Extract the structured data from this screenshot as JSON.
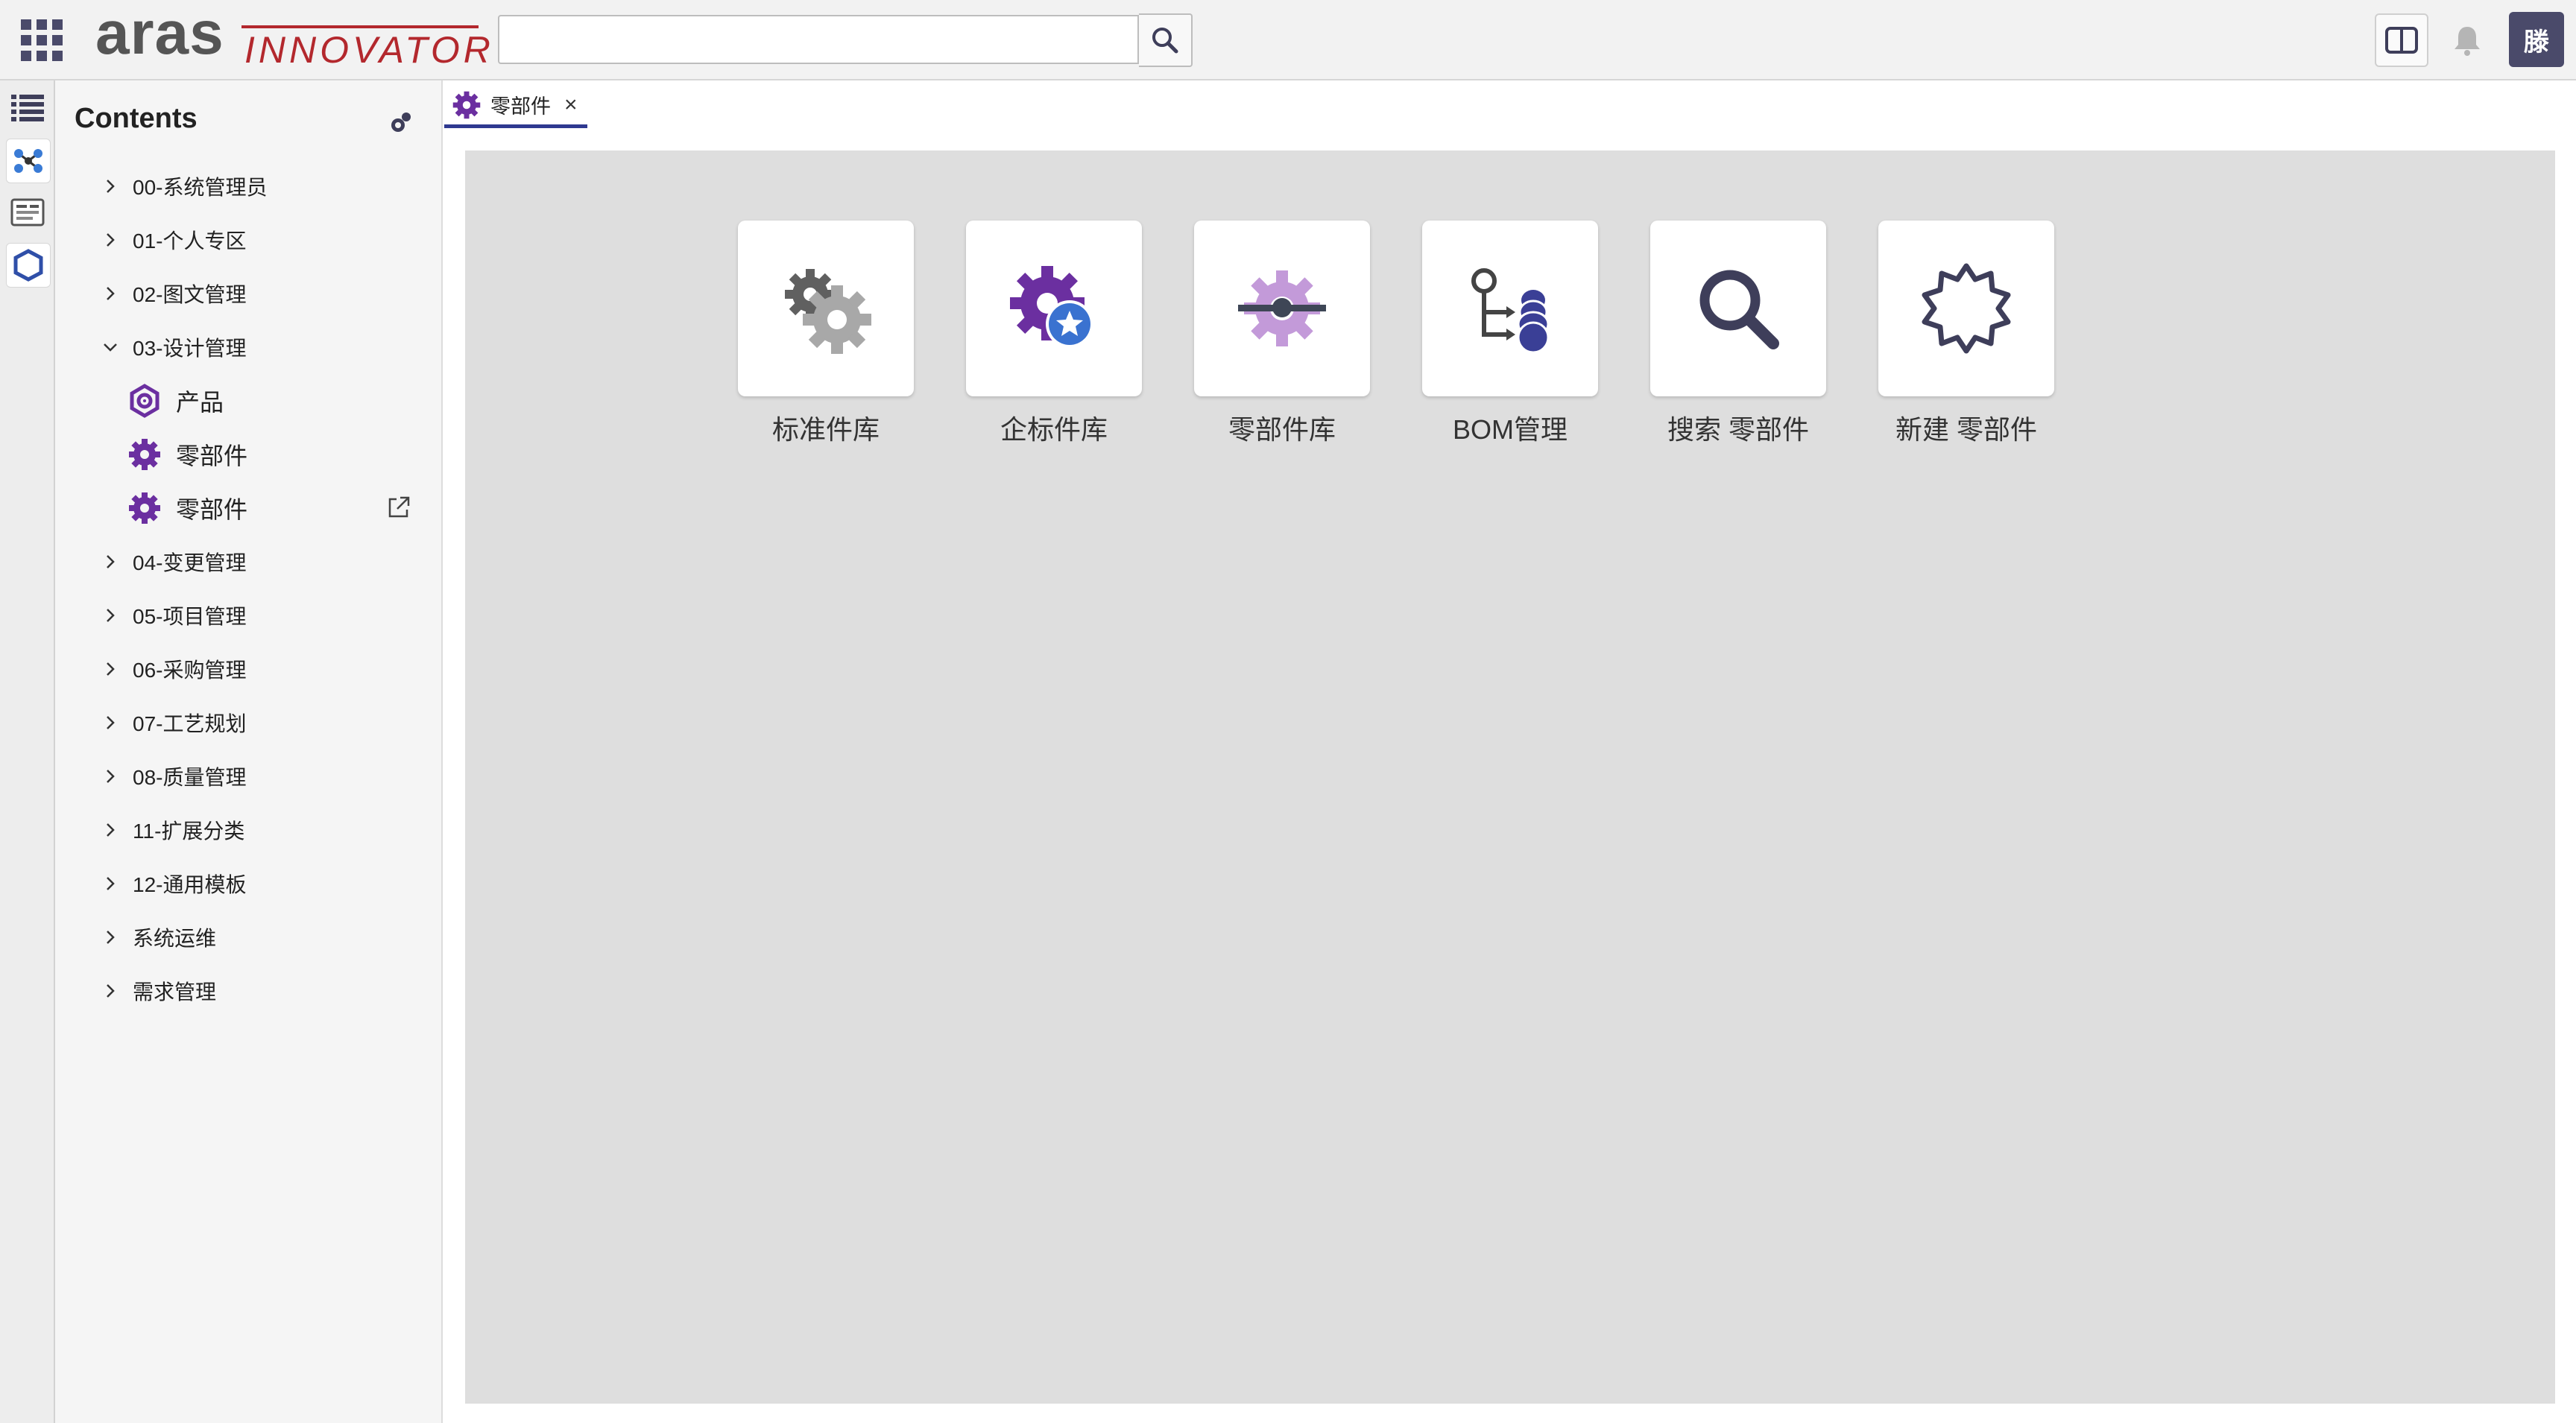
{
  "header": {
    "logo_text": "aras",
    "logo_sub": "INNOVATOR",
    "search": {
      "value": "",
      "placeholder": ""
    },
    "user_avatar": "滕"
  },
  "nav": {
    "title": "Contents",
    "items": [
      {
        "label": "00-系统管理员",
        "expanded": false
      },
      {
        "label": "01-个人专区",
        "expanded": false
      },
      {
        "label": "02-图文管理",
        "expanded": false
      },
      {
        "label": "03-设计管理",
        "expanded": true,
        "children": [
          {
            "label": "产品",
            "icon": "product-gear-icon"
          },
          {
            "label": "零部件",
            "icon": "gear-icon"
          },
          {
            "label": "零部件",
            "icon": "gear-icon",
            "external": true
          }
        ]
      },
      {
        "label": "04-变更管理",
        "expanded": false
      },
      {
        "label": "05-项目管理",
        "expanded": false
      },
      {
        "label": "06-采购管理",
        "expanded": false
      },
      {
        "label": "07-工艺规划",
        "expanded": false
      },
      {
        "label": "08-质量管理",
        "expanded": false
      },
      {
        "label": "11-扩展分类",
        "expanded": false
      },
      {
        "label": "12-通用模板",
        "expanded": false
      },
      {
        "label": "系统运维",
        "expanded": false
      },
      {
        "label": "需求管理",
        "expanded": false
      }
    ]
  },
  "tab": {
    "label": "零部件",
    "close": "×"
  },
  "tiles": [
    {
      "label": "标准件库",
      "icon": "gears-icon"
    },
    {
      "label": "企标件库",
      "icon": "gear-star-icon"
    },
    {
      "label": "零部件库",
      "icon": "gear-slider-icon"
    },
    {
      "label": "BOM管理",
      "icon": "bom-structure-icon"
    },
    {
      "label": "搜索 零部件",
      "icon": "magnifier-icon"
    },
    {
      "label": "新建 零部件",
      "icon": "new-badge-icon"
    }
  ],
  "colors": {
    "accent": "#2f3990",
    "brand_red": "#b3282d",
    "purple": "#6b2fa0",
    "light_purple": "#c39ad9",
    "canvas_bg": "#dedede",
    "header_bg": "#f2f2f2"
  }
}
